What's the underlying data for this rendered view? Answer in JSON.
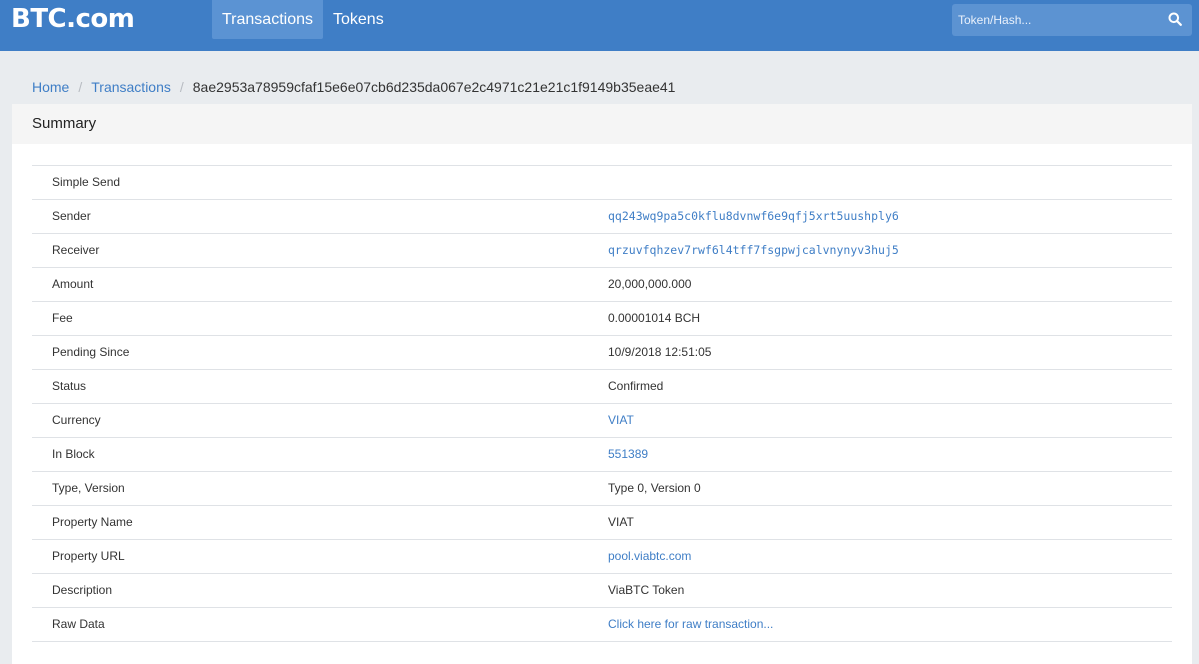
{
  "header": {
    "logo": "BTC.com",
    "nav": [
      {
        "label": "Transactions",
        "active": true
      },
      {
        "label": "Tokens",
        "active": false
      }
    ],
    "search": {
      "placeholder": "Token/Hash...",
      "icon": "search-icon"
    }
  },
  "breadcrumb": {
    "home": "Home",
    "transactions": "Transactions",
    "current": "8ae2953a78959cfaf15e6e07cb6d235da067e2c4971c21e21c1f9149b35eae41"
  },
  "summary": {
    "title": "Summary",
    "rows": [
      {
        "label": "Simple Send",
        "value": ""
      },
      {
        "label": "Sender",
        "value": "qq243wq9pa5c0kflu8dvnwf6e9qfj5xrt5uushply6"
      },
      {
        "label": "Receiver",
        "value": "qrzuvfqhzev7rwf6l4tff7fsgpwjcalvnynyv3huj5"
      },
      {
        "label": "Amount",
        "value": "20,000,000.000"
      },
      {
        "label": "Fee",
        "value": "0.00001014 BCH"
      },
      {
        "label": "Pending Since",
        "value": "10/9/2018 12:51:05"
      },
      {
        "label": "Status",
        "value": "Confirmed"
      },
      {
        "label": "Currency",
        "value": "VIAT"
      },
      {
        "label": "In Block",
        "value": "551389"
      },
      {
        "label": "Type, Version",
        "value": "Type 0, Version 0"
      },
      {
        "label": "Property Name",
        "value": "VIAT"
      },
      {
        "label": "Property URL",
        "value": "pool.viabtc.com"
      },
      {
        "label": "Description",
        "value": "ViaBTC Token"
      },
      {
        "label": "Raw Data",
        "value": "Click here for raw transaction..."
      }
    ]
  },
  "colors": {
    "brand": "#3f7ec6",
    "link": "#3f7ec6"
  }
}
